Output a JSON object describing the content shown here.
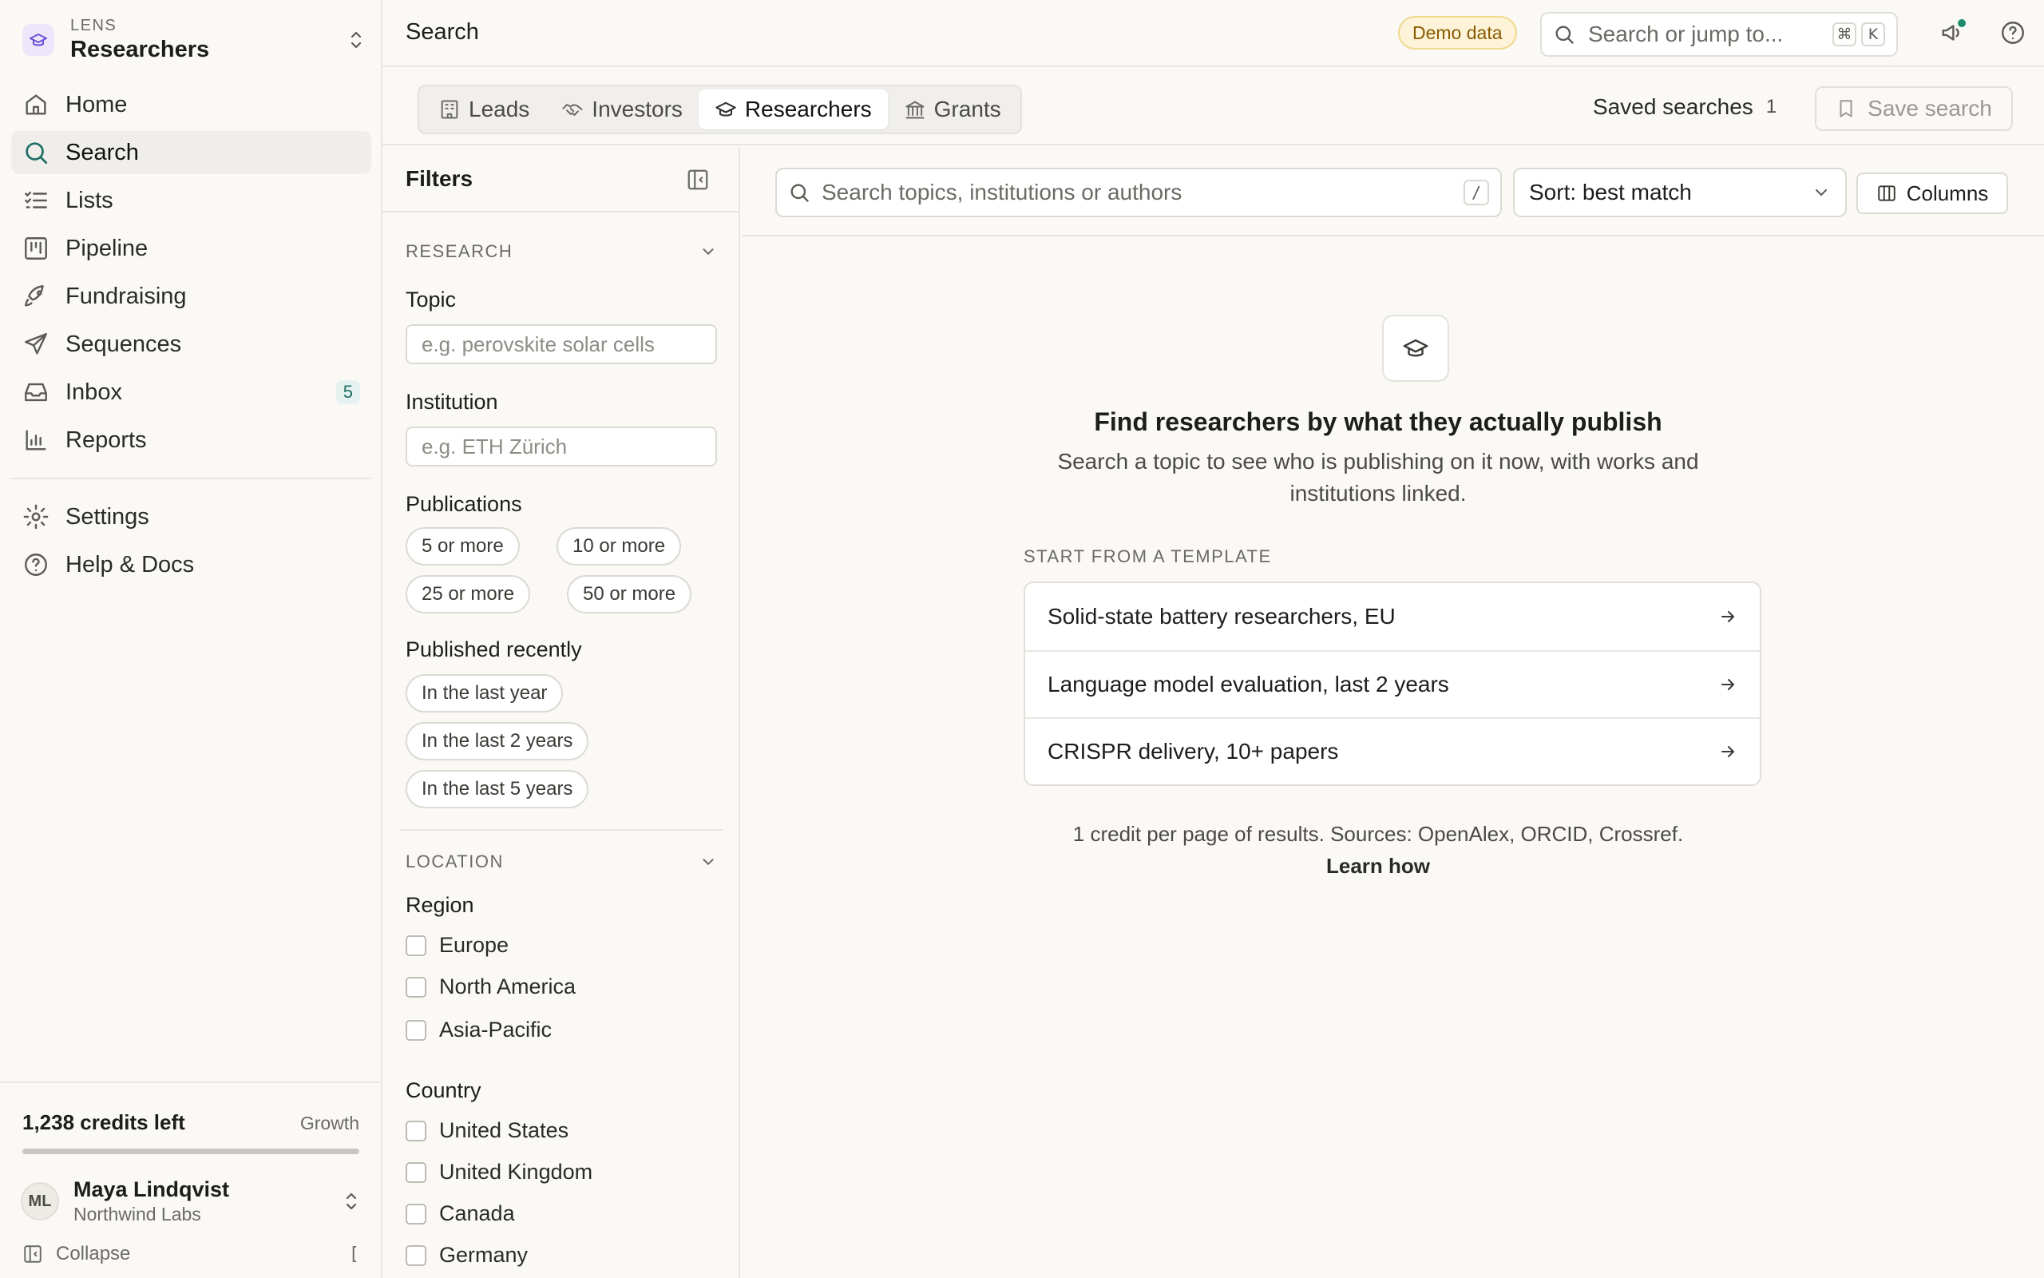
{
  "workspace": {
    "kicker": "LENS",
    "name": "Researchers"
  },
  "nav": {
    "items": [
      {
        "label": "Home",
        "icon": "home-icon"
      },
      {
        "label": "Search",
        "icon": "search-icon",
        "active": true
      },
      {
        "label": "Lists",
        "icon": "list-icon"
      },
      {
        "label": "Pipeline",
        "icon": "kanban-icon"
      },
      {
        "label": "Fundraising",
        "icon": "rocket-icon"
      },
      {
        "label": "Sequences",
        "icon": "send-icon"
      },
      {
        "label": "Inbox",
        "icon": "inbox-icon",
        "badge": "5"
      },
      {
        "label": "Reports",
        "icon": "bar-chart-icon"
      }
    ],
    "secondary": [
      {
        "label": "Settings",
        "icon": "gear-icon"
      },
      {
        "label": "Help & Docs",
        "icon": "help-circle-icon"
      }
    ]
  },
  "credits": {
    "text": "1,238 credits left",
    "plan": "Growth",
    "fraction": 1.0
  },
  "user": {
    "initials": "ML",
    "name": "Maya Lindqvist",
    "org": "Northwind Labs"
  },
  "collapse": {
    "label": "Collapse",
    "shortcut": "["
  },
  "header": {
    "title": "Search",
    "demo_badge": "Demo data",
    "search_placeholder": "Search or jump to...",
    "shortcut_cmd": "⌘",
    "shortcut_key": "K"
  },
  "tabs": [
    {
      "label": "Leads",
      "icon": "building-icon"
    },
    {
      "label": "Investors",
      "icon": "handshake-icon"
    },
    {
      "label": "Researchers",
      "icon": "graduation-cap-icon",
      "active": true
    },
    {
      "label": "Grants",
      "icon": "bank-icon"
    }
  ],
  "saved_searches": {
    "label": "Saved searches",
    "count": "1"
  },
  "save_search": {
    "label": "Save search"
  },
  "filters": {
    "title": "Filters",
    "research": {
      "title": "RESEARCH",
      "topic_label": "Topic",
      "topic_placeholder": "e.g. perovskite solar cells",
      "institution_label": "Institution",
      "institution_placeholder": "e.g. ETH Zürich",
      "publications_label": "Publications",
      "publications": [
        "5 or more",
        "10 or more",
        "25 or more",
        "50 or more"
      ],
      "recency_label": "Published recently",
      "recency": [
        "In the last year",
        "In the last 2 years",
        "In the last 5 years"
      ]
    },
    "location": {
      "title": "LOCATION",
      "region_label": "Region",
      "regions": [
        "Europe",
        "North America",
        "Asia-Pacific"
      ],
      "country_label": "Country",
      "countries": [
        "United States",
        "United Kingdom",
        "Canada",
        "Germany"
      ]
    }
  },
  "results": {
    "search_placeholder": "Search topics, institutions or authors",
    "slash_key": "/",
    "sort_label": "Sort: best match",
    "columns_label": "Columns"
  },
  "empty_state": {
    "title": "Find researchers by what they actually publish",
    "description": "Search a topic to see who is publishing on it now, with works and institutions linked.",
    "templates_kicker": "START FROM A TEMPLATE",
    "templates": [
      "Solid-state battery researchers, EU",
      "Language model evaluation, last 2 years",
      "CRISPR delivery, 10+ papers"
    ],
    "footnote": "1 credit per page of results. Sources: OpenAlex, ORCID, Crossref.",
    "learn_link": "Learn how"
  }
}
